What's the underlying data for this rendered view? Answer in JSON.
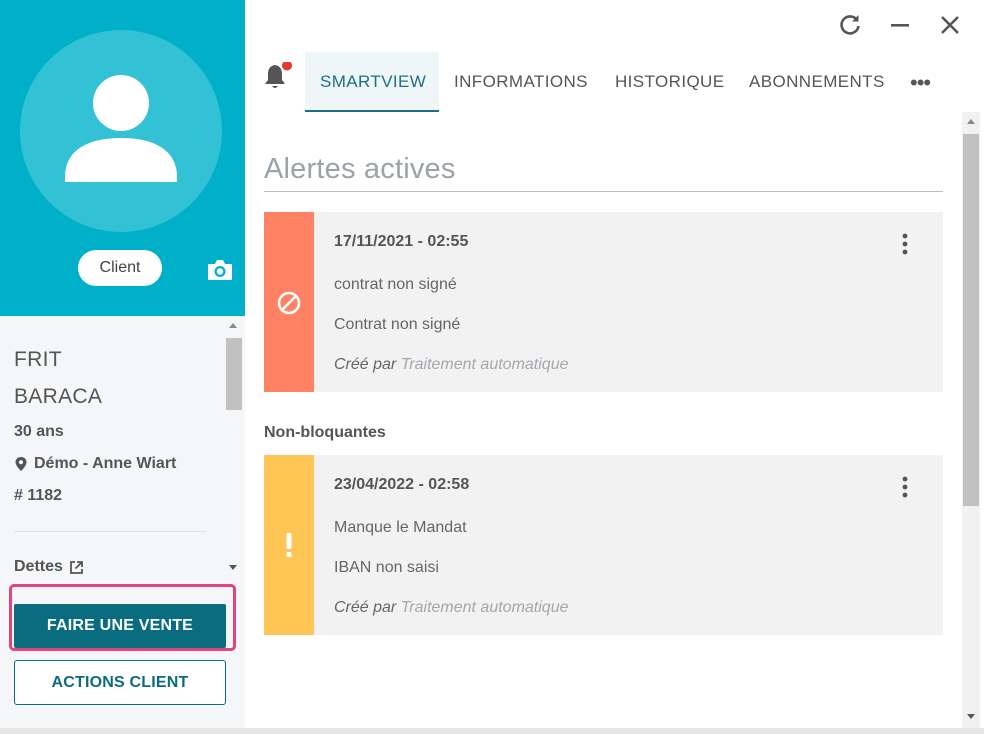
{
  "profile": {
    "role": "Client",
    "last_name": "FRIT",
    "first_name": "BARACA",
    "age": "30 ans",
    "location": "Démo - Anne Wiart",
    "id": "# 1182",
    "debts_label": "Dettes"
  },
  "actions": {
    "sale_label": "FAIRE UNE VENTE",
    "client_actions_label": "ACTIONS CLIENT"
  },
  "tabs": [
    {
      "label": "SMARTVIEW",
      "active": true
    },
    {
      "label": "INFORMATIONS",
      "active": false
    },
    {
      "label": "HISTORIQUE",
      "active": false
    },
    {
      "label": "ABONNEMENTS",
      "active": false
    }
  ],
  "tabs_more": "•••",
  "main": {
    "section_title": "Alertes actives",
    "non_blocking_label": "Non-bloquantes",
    "blocking_alert": {
      "date": "17/11/2021 - 02:55",
      "line1": "contrat non signé",
      "line2": "Contrat non signé",
      "created_by_label": "Créé par",
      "created_by": "Traitement automatique"
    },
    "warning_alert": {
      "date": "23/04/2022 - 02:58",
      "line1": "Manque le Mandat",
      "line2": "IBAN non saisi",
      "created_by_label": "Créé par",
      "created_by": "Traitement automatique"
    }
  },
  "colors": {
    "header_teal": "#00b0c9",
    "primary_dark": "#0a6c7f",
    "blocking_red": "#ff8265",
    "warning_yellow": "#ffc656",
    "highlight_pink": "#e0457b",
    "notification_dot": "#e53935"
  },
  "icons": [
    "user-avatar-icon",
    "camera-icon",
    "location-pin-icon",
    "external-link-icon",
    "bell-icon",
    "refresh-icon",
    "minimize-icon",
    "close-icon",
    "blocked-icon",
    "exclamation-icon",
    "kebab-menu-icon"
  ]
}
